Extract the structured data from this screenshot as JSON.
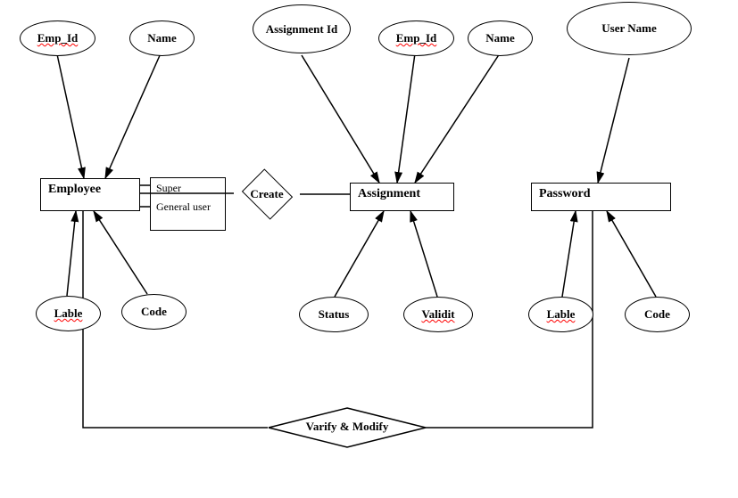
{
  "entities": {
    "employee": "Employee",
    "assignment": "Assignment",
    "password": "Password"
  },
  "attributes": {
    "emp_id_1": "Emp_Id",
    "name_1": "Name",
    "assignment_id": "Assignment Id",
    "emp_id_2": "Emp_Id",
    "name_2": "Name",
    "user_name": "User Name",
    "lable_1": "Lable",
    "code_1": "Code",
    "status": "Status",
    "validit": "Validit",
    "lable_2": "Lable",
    "code_2": "Code"
  },
  "relationships": {
    "create": "Create",
    "varify_modify": "Varify & Modify"
  },
  "labels": {
    "super": "Super",
    "general_user": "General user"
  }
}
